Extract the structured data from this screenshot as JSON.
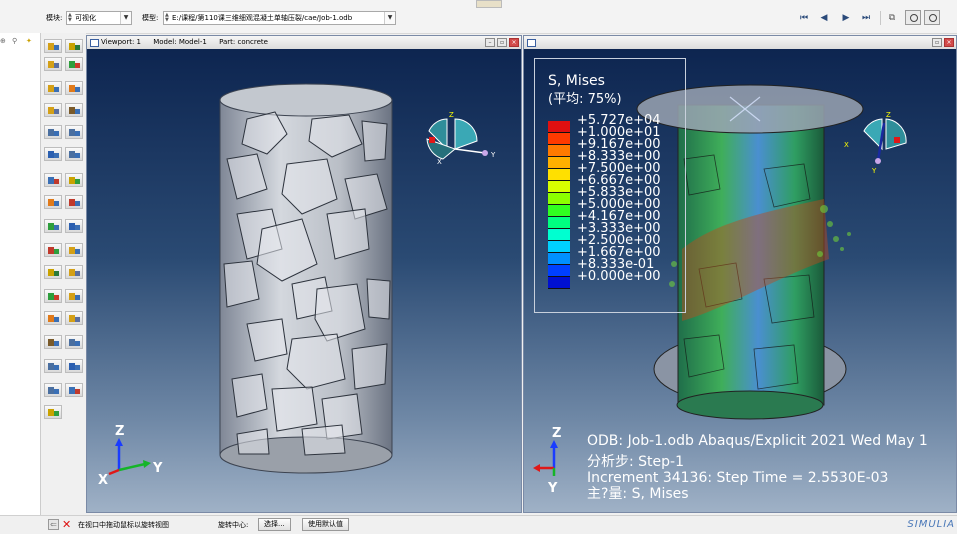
{
  "toolbar": {
    "module_label": "模块:",
    "module_value": "可视化",
    "model_label": "模型:",
    "model_value": "E:/课程/第110课三维细观混凝土单轴压裂/cae/Job-1.odb"
  },
  "viewport1": {
    "title": "Viewport: 1",
    "model": "Model: Model-1",
    "part": "Part: concrete",
    "axes": {
      "z": "Z",
      "x": "X",
      "y": "Y"
    }
  },
  "viewport2": {
    "legend": {
      "title": "S, Mises",
      "average": "(平均: 75%)",
      "values": [
        "+5.727e+04",
        "+1.000e+01",
        "+9.167e+00",
        "+8.333e+00",
        "+7.500e+00",
        "+6.667e+00",
        "+5.833e+00",
        "+5.000e+00",
        "+4.167e+00",
        "+3.333e+00",
        "+2.500e+00",
        "+1.667e+00",
        "+8.333e-01",
        "+0.000e+00"
      ],
      "colors": [
        "#e01010",
        "#ff3a00",
        "#ff7a00",
        "#ffb000",
        "#ffe000",
        "#d8ff00",
        "#8cff00",
        "#30ff20",
        "#00ff80",
        "#00ffd0",
        "#00d0ff",
        "#0090ff",
        "#0040ff",
        "#0010d0"
      ]
    },
    "axes": {
      "z": "Z",
      "x": "X",
      "y": "Y"
    },
    "info": {
      "line1": "ODB: Job-1.odb    Abaqus/Explicit 2021    Wed May 1",
      "line2": "分析步: Step-1",
      "line3": "Increment    34136: Step Time =    2.5530E-03",
      "line4": "主?量: S, Mises"
    }
  },
  "status": {
    "prompt": "在视口中拖动鼠标以旋转视图",
    "center_label": "旋转中心:",
    "select_button": "选择...",
    "default_button": "使用默认值",
    "brand": "SIMULIA"
  },
  "icons": [
    "cancel-icon",
    "close-x-icon",
    "rotate-icon",
    "first-frame-icon",
    "previous-frame-icon",
    "next-frame-icon",
    "last-frame-icon",
    "camera-icon",
    "print-icon"
  ]
}
